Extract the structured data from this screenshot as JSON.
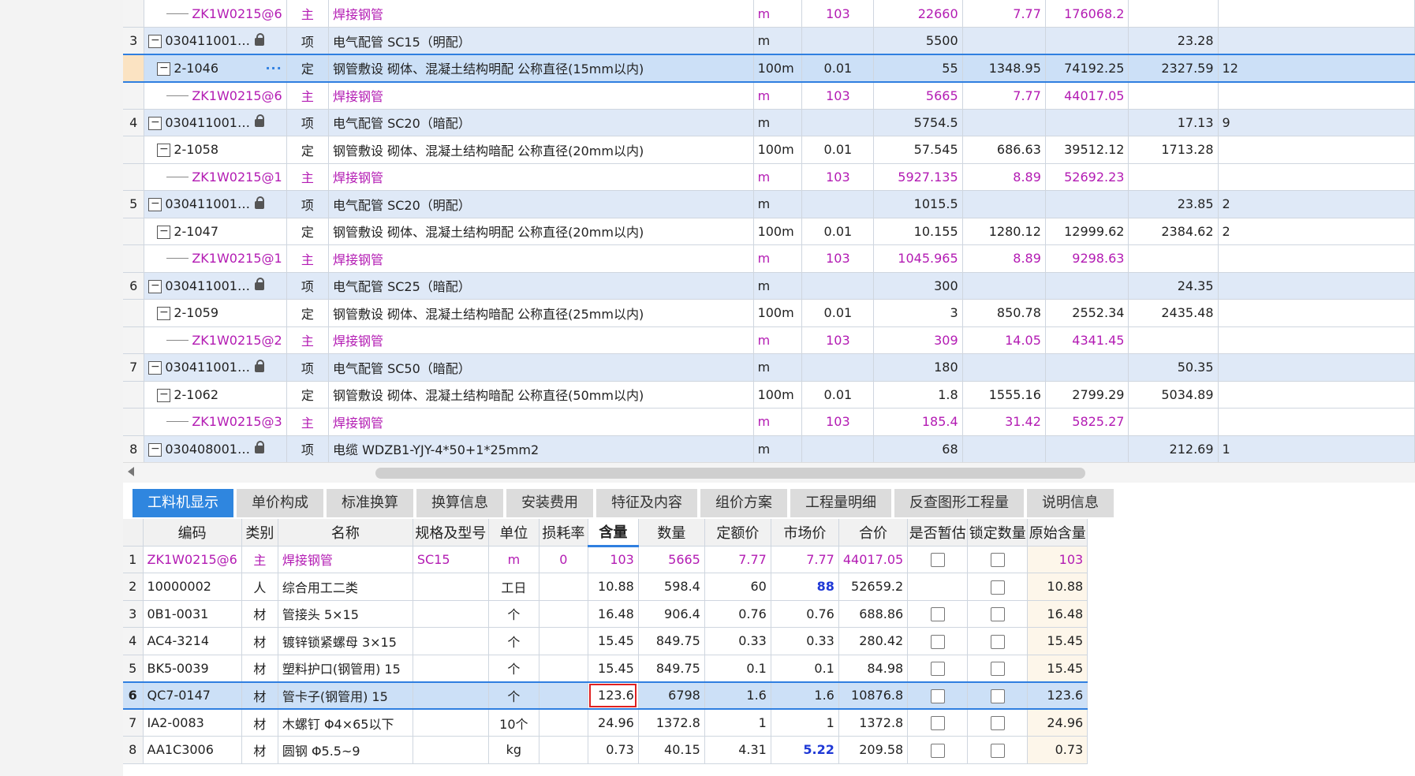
{
  "top_rows": [
    {
      "type": "zhu",
      "idx": "",
      "code": "ZK1W0215@6",
      "kind": "主",
      "name": "焊接钢管",
      "unit": "m",
      "gcl_expr": "103",
      "qty": "22660",
      "price": "7.77",
      "total": "176068.2",
      "zhs": "",
      "last": ""
    },
    {
      "type": "xiang",
      "idx": "3",
      "code": "030411001…",
      "kind": "项",
      "name": "电气配管 SC15（明配）",
      "unit": "m",
      "gcl_expr": "",
      "qty": "5500",
      "price": "",
      "total": "",
      "zhs": "23.28",
      "last": ""
    },
    {
      "type": "ding",
      "sel": true,
      "idx": "",
      "code": "2-1046",
      "kind": "定",
      "name": "钢管敷设 砌体、混凝土结构明配 公称直径(15mm以内)",
      "unit": "100m",
      "gcl_expr": "0.01",
      "qty": "55",
      "price": "1348.95",
      "total": "74192.25",
      "zhs": "2327.59",
      "last": "12"
    },
    {
      "type": "zhu",
      "idx": "",
      "code": "ZK1W0215@6",
      "kind": "主",
      "name": "焊接钢管",
      "unit": "m",
      "gcl_expr": "103",
      "qty": "5665",
      "price": "7.77",
      "total": "44017.05",
      "zhs": "",
      "last": ""
    },
    {
      "type": "xiang",
      "idx": "4",
      "code": "030411001…",
      "kind": "项",
      "name": "电气配管 SC20（暗配）",
      "unit": "m",
      "gcl_expr": "",
      "qty": "5754.5",
      "price": "",
      "total": "",
      "zhs": "17.13",
      "last": "9"
    },
    {
      "type": "ding",
      "idx": "",
      "code": "2-1058",
      "kind": "定",
      "name": "钢管敷设 砌体、混凝土结构暗配 公称直径(20mm以内)",
      "unit": "100m",
      "gcl_expr": "0.01",
      "qty": "57.545",
      "price": "686.63",
      "total": "39512.12",
      "zhs": "1713.28",
      "last": ""
    },
    {
      "type": "zhu",
      "idx": "",
      "code": "ZK1W0215@1",
      "kind": "主",
      "name": "焊接钢管",
      "unit": "m",
      "gcl_expr": "103",
      "qty": "5927.135",
      "price": "8.89",
      "total": "52692.23",
      "zhs": "",
      "last": ""
    },
    {
      "type": "xiang",
      "idx": "5",
      "code": "030411001…",
      "kind": "项",
      "name": "电气配管 SC20（明配）",
      "unit": "m",
      "gcl_expr": "",
      "qty": "1015.5",
      "price": "",
      "total": "",
      "zhs": "23.85",
      "last": "2"
    },
    {
      "type": "ding",
      "idx": "",
      "code": "2-1047",
      "kind": "定",
      "name": "钢管敷设 砌体、混凝土结构明配 公称直径(20mm以内)",
      "unit": "100m",
      "gcl_expr": "0.01",
      "qty": "10.155",
      "price": "1280.12",
      "total": "12999.62",
      "zhs": "2384.62",
      "last": "2"
    },
    {
      "type": "zhu",
      "idx": "",
      "code": "ZK1W0215@1",
      "kind": "主",
      "name": "焊接钢管",
      "unit": "m",
      "gcl_expr": "103",
      "qty": "1045.965",
      "price": "8.89",
      "total": "9298.63",
      "zhs": "",
      "last": ""
    },
    {
      "type": "xiang",
      "idx": "6",
      "code": "030411001…",
      "kind": "项",
      "name": "电气配管 SC25（暗配）",
      "unit": "m",
      "gcl_expr": "",
      "qty": "300",
      "price": "",
      "total": "",
      "zhs": "24.35",
      "last": ""
    },
    {
      "type": "ding",
      "idx": "",
      "code": "2-1059",
      "kind": "定",
      "name": "钢管敷设 砌体、混凝土结构暗配 公称直径(25mm以内)",
      "unit": "100m",
      "gcl_expr": "0.01",
      "qty": "3",
      "price": "850.78",
      "total": "2552.34",
      "zhs": "2435.48",
      "last": ""
    },
    {
      "type": "zhu",
      "idx": "",
      "code": "ZK1W0215@2",
      "kind": "主",
      "name": "焊接钢管",
      "unit": "m",
      "gcl_expr": "103",
      "qty": "309",
      "price": "14.05",
      "total": "4341.45",
      "zhs": "",
      "last": ""
    },
    {
      "type": "xiang",
      "idx": "7",
      "code": "030411001…",
      "kind": "项",
      "name": "电气配管 SC50（暗配）",
      "unit": "m",
      "gcl_expr": "",
      "qty": "180",
      "price": "",
      "total": "",
      "zhs": "50.35",
      "last": ""
    },
    {
      "type": "ding",
      "idx": "",
      "code": "2-1062",
      "kind": "定",
      "name": "钢管敷设 砌体、混凝土结构暗配 公称直径(50mm以内)",
      "unit": "100m",
      "gcl_expr": "0.01",
      "qty": "1.8",
      "price": "1555.16",
      "total": "2799.29",
      "zhs": "5034.89",
      "last": ""
    },
    {
      "type": "zhu",
      "idx": "",
      "code": "ZK1W0215@3",
      "kind": "主",
      "name": "焊接钢管",
      "unit": "m",
      "gcl_expr": "103",
      "qty": "185.4",
      "price": "31.42",
      "total": "5825.27",
      "zhs": "",
      "last": ""
    },
    {
      "type": "xiang",
      "idx": "8",
      "code": "030408001…",
      "kind": "项",
      "name": "电缆 WDZB1-YJY-4*50+1*25mm2",
      "unit": "m",
      "gcl_expr": "",
      "qty": "68",
      "price": "",
      "total": "",
      "zhs": "212.69",
      "last": "1"
    }
  ],
  "tabs": [
    "工料机显示",
    "单价构成",
    "标准换算",
    "换算信息",
    "安装费用",
    "特征及内容",
    "组价方案",
    "工程量明细",
    "反查图形工程量",
    "说明信息"
  ],
  "bottom_headers": [
    "",
    "编码",
    "类别",
    "名称",
    "规格及型号",
    "单位",
    "损耗率",
    "含量",
    "数量",
    "定额价",
    "市场价",
    "合价",
    "是否暂估",
    "锁定数量",
    "原始含量"
  ],
  "bottom_rows": [
    {
      "idx": "1",
      "code": "ZK1W0215@6",
      "kind": "主",
      "name": "焊接钢管",
      "spec": "SC15",
      "unit": "m",
      "loss": "0",
      "content": "103",
      "qty": "5665",
      "dep": "7.77",
      "mkt": "7.77",
      "total": "44017.05",
      "est": true,
      "lock": true,
      "orig": "103",
      "zhu": true
    },
    {
      "idx": "2",
      "code": "10000002",
      "kind": "人",
      "name": "综合用工二类",
      "spec": "",
      "unit": "工日",
      "loss": "",
      "content": "10.88",
      "qty": "598.4",
      "dep": "60",
      "mkt": "88",
      "mkt_bold": true,
      "total": "52659.2",
      "est": false,
      "lock": true,
      "orig": "10.88"
    },
    {
      "idx": "3",
      "code": "0B1-0031",
      "kind": "材",
      "name": "管接头 5×15",
      "spec": "",
      "unit": "个",
      "loss": "",
      "content": "16.48",
      "qty": "906.4",
      "dep": "0.76",
      "mkt": "0.76",
      "total": "688.86",
      "est": true,
      "lock": true,
      "orig": "16.48"
    },
    {
      "idx": "4",
      "code": "AC4-3214",
      "kind": "材",
      "name": "镀锌锁紧螺母 3×15",
      "spec": "",
      "unit": "个",
      "loss": "",
      "content": "15.45",
      "qty": "849.75",
      "dep": "0.33",
      "mkt": "0.33",
      "total": "280.42",
      "est": true,
      "lock": true,
      "orig": "15.45"
    },
    {
      "idx": "5",
      "code": "BK5-0039",
      "kind": "材",
      "name": "塑料护口(钢管用) 15",
      "spec": "",
      "unit": "个",
      "loss": "",
      "content": "15.45",
      "qty": "849.75",
      "dep": "0.1",
      "mkt": "0.1",
      "total": "84.98",
      "est": true,
      "lock": true,
      "orig": "15.45"
    },
    {
      "idx": "6",
      "code": "QC7-0147",
      "kind": "材",
      "name": "管卡子(钢管用) 15",
      "spec": "",
      "unit": "个",
      "loss": "",
      "content": "123.6",
      "qty": "6798",
      "dep": "1.6",
      "mkt": "1.6",
      "total": "10876.8",
      "est": true,
      "lock": true,
      "orig": "123.6",
      "sel": true
    },
    {
      "idx": "7",
      "code": "IA2-0083",
      "kind": "材",
      "name": "木螺钉 Φ4×65以下",
      "spec": "",
      "unit": "10个",
      "loss": "",
      "content": "24.96",
      "qty": "1372.8",
      "dep": "1",
      "mkt": "1",
      "total": "1372.8",
      "est": true,
      "lock": true,
      "orig": "24.96"
    },
    {
      "idx": "8",
      "code": "AA1C3006",
      "kind": "材",
      "name": "圆钢 Φ5.5~9",
      "spec": "",
      "unit": "kg",
      "loss": "",
      "content": "0.73",
      "qty": "40.15",
      "dep": "4.31",
      "mkt": "5.22",
      "mkt_bold": true,
      "total": "209.58",
      "est": true,
      "lock": true,
      "orig": "0.73"
    }
  ]
}
